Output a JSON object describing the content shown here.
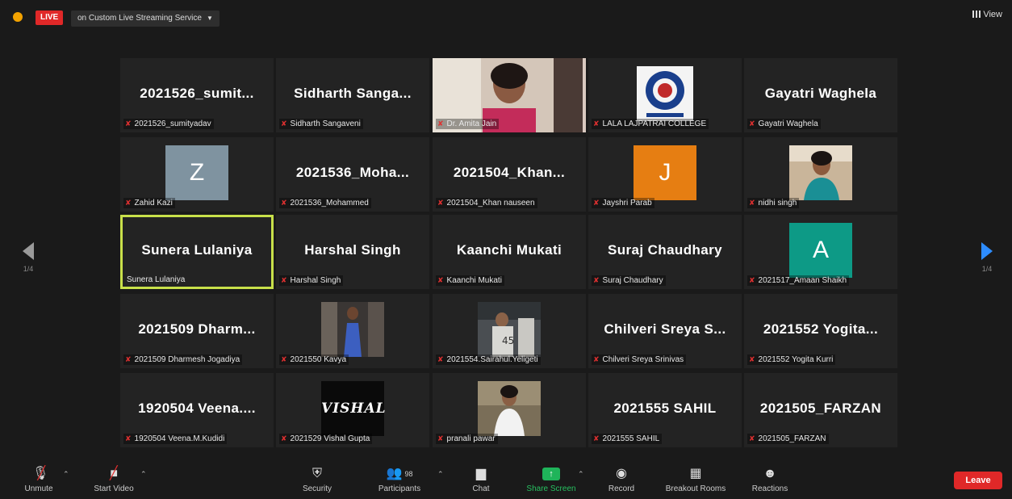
{
  "topbar": {
    "live_label": "LIVE",
    "stream_label": "on Custom Live Streaming Service",
    "view_label": "View"
  },
  "nav": {
    "left_page": "1/4",
    "right_page": "1/4"
  },
  "tiles": [
    {
      "big": "2021526_sumit...",
      "label": "2021526_sumityadav"
    },
    {
      "big": "Sidharth Sanga...",
      "label": "Sidharth Sangaveni"
    },
    {
      "big": "",
      "label": "Dr. Amita Jain"
    },
    {
      "big": "",
      "label": "LALA LAJPATRAI COLLEGE"
    },
    {
      "big": "Gayatri Waghela",
      "label": "Gayatri Waghela"
    },
    {
      "big": "",
      "label": "Zahid Kazi",
      "avatar": "Z"
    },
    {
      "big": "2021536_Moha...",
      "label": "2021536_Mohammed"
    },
    {
      "big": "2021504_Khan...",
      "label": "2021504_Khan nauseen"
    },
    {
      "big": "",
      "label": "Jayshri Parab",
      "avatar": "J"
    },
    {
      "big": "",
      "label": "nidhi singh"
    },
    {
      "big": "Sunera Lulaniya",
      "label": "Sunera Lulaniya"
    },
    {
      "big": "Harshal Singh",
      "label": "Harshal Singh"
    },
    {
      "big": "Kaanchi Mukati",
      "label": "Kaanchi Mukati"
    },
    {
      "big": "Suraj Chaudhary",
      "label": "Suraj Chaudhary"
    },
    {
      "big": "",
      "label": "2021517_Amaan Shaikh",
      "avatar": "A"
    },
    {
      "big": "2021509 Dharm...",
      "label": "2021509 Dharmesh Jogadiya"
    },
    {
      "big": "",
      "label": "2021550 Kavya"
    },
    {
      "big": "",
      "label": "2021554.Sairahul.Yeligeti"
    },
    {
      "big": "Chilveri Sreya S...",
      "label": "Chilveri Sreya Srinivas"
    },
    {
      "big": "2021552 Yogita...",
      "label": "2021552 Yogita Kurri"
    },
    {
      "big": "1920504 Veena....",
      "label": "1920504 Veena.M.Kudidi"
    },
    {
      "big": "",
      "label": "2021529 Vishal Gupta",
      "logo": "VISHAL"
    },
    {
      "big": "",
      "label": "pranali pawar"
    },
    {
      "big": "2021555 SAHIL",
      "label": "2021555 SAHIL"
    },
    {
      "big": "2021505_FARZAN",
      "label": "2021505_FARZAN"
    }
  ],
  "toolbar": {
    "unmute": "Unmute",
    "start_video": "Start Video",
    "security": "Security",
    "participants": "Participants",
    "participants_count": "98",
    "chat": "Chat",
    "share_screen": "Share Screen",
    "record": "Record",
    "breakout_rooms": "Breakout Rooms",
    "reactions": "Reactions",
    "leave": "Leave"
  },
  "colors": {
    "live": "#e02828",
    "active_border": "#c8e04a",
    "share_green": "#1fb45a",
    "avatar_z": "#7f93a0",
    "avatar_j": "#e67e12",
    "avatar_a": "#0d9a86"
  }
}
